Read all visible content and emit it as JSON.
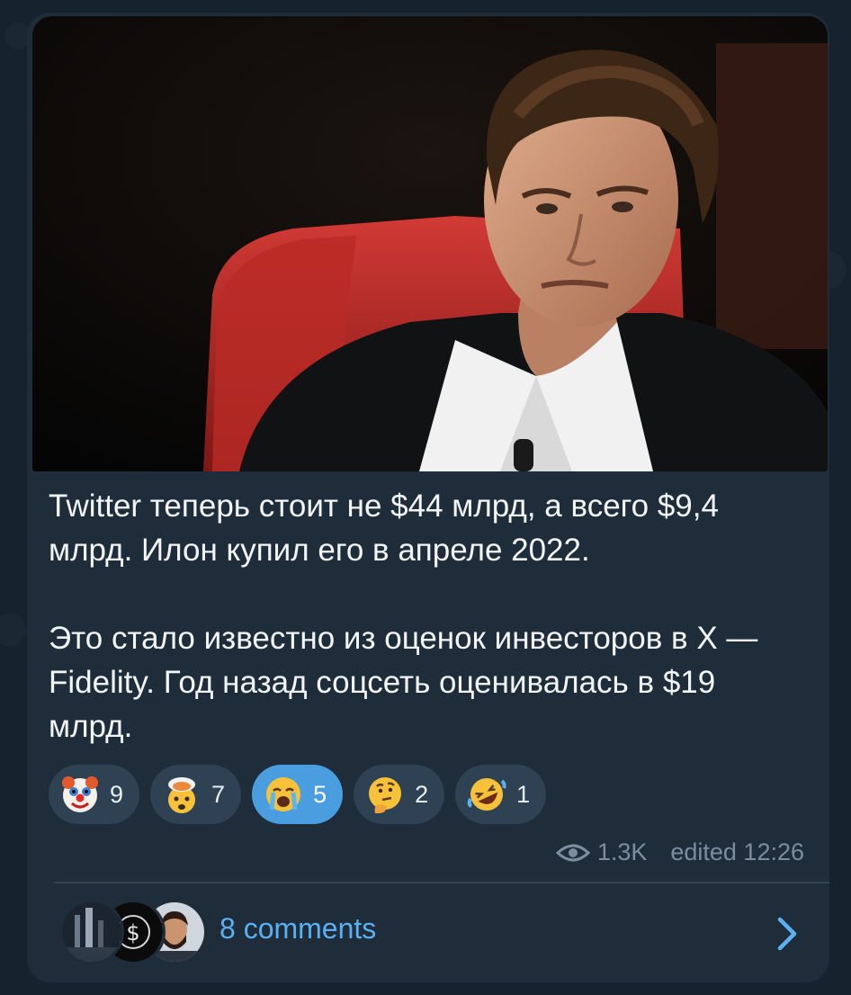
{
  "post": {
    "photo_alt": "",
    "text_paragraph_1": "Twitter теперь стоит не $44 млрд, а всего $9,4 млрд. Илон купил его в апреле 2022.",
    "text_paragraph_2": "Это стало известно из оценок инвесторов в X — Fidelity. Год назад соцсеть оценивалась в $19 млрд."
  },
  "reactions": [
    {
      "icon": "clown-face-icon",
      "count": "9",
      "active": false
    },
    {
      "icon": "exploding-head-icon",
      "count": "7",
      "active": false
    },
    {
      "icon": "crying-face-icon",
      "count": "5",
      "active": true
    },
    {
      "icon": "thinking-face-icon",
      "count": "2",
      "active": false
    },
    {
      "icon": "rolling-laughing-icon",
      "count": "1",
      "active": false
    }
  ],
  "meta": {
    "views": "1.3K",
    "edited_label": "edited 12:26"
  },
  "comments": {
    "label": "8 comments"
  },
  "colors": {
    "background": "#16222e",
    "bubble": "#1f2c3a",
    "reaction_bg": "#2f4254",
    "reaction_active": "#4a9ee0",
    "link": "#5ab0f2",
    "meta": "#7c8d9e"
  }
}
